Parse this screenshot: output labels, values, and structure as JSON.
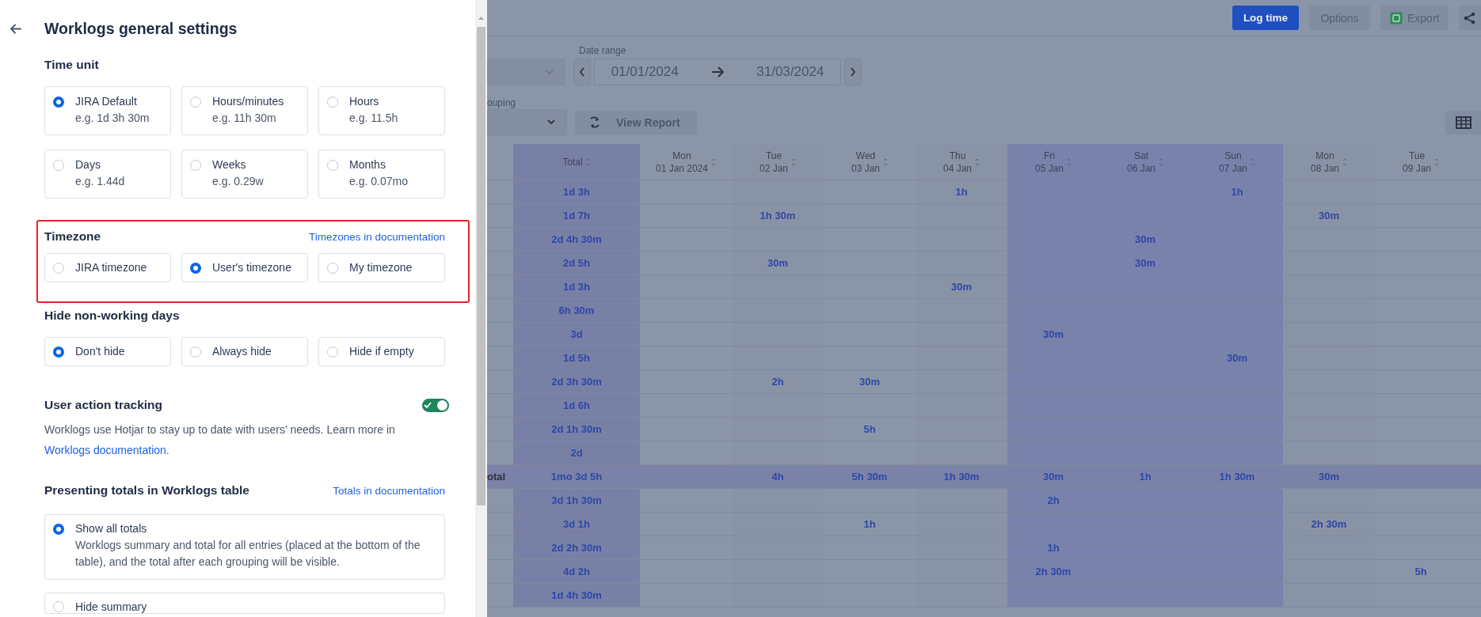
{
  "panel": {
    "title": "Worklogs general settings"
  },
  "time_unit": {
    "title": "Time unit",
    "options": [
      {
        "label": "JIRA Default",
        "example": "e.g. 1d 3h 30m",
        "selected": true
      },
      {
        "label": "Hours/minutes",
        "example": "e.g. 11h 30m",
        "selected": false
      },
      {
        "label": "Hours",
        "example": "e.g. 11.5h",
        "selected": false
      },
      {
        "label": "Days",
        "example": "e.g. 1.44d",
        "selected": false
      },
      {
        "label": "Weeks",
        "example": "e.g. 0.29w",
        "selected": false
      },
      {
        "label": "Months",
        "example": "e.g. 0.07mo",
        "selected": false
      }
    ]
  },
  "timezone": {
    "title": "Timezone",
    "link": "Timezones in documentation",
    "highlighted": true,
    "options": [
      {
        "label": "JIRA timezone",
        "selected": false
      },
      {
        "label": "User's timezone",
        "selected": true
      },
      {
        "label": "My timezone",
        "selected": false
      }
    ]
  },
  "hide_non_working_days": {
    "title": "Hide non-working days",
    "options": [
      {
        "label": "Don't hide",
        "selected": true
      },
      {
        "label": "Always hide",
        "selected": false
      },
      {
        "label": "Hide if empty",
        "selected": false
      }
    ]
  },
  "user_action_tracking": {
    "title": "User action tracking",
    "on": true,
    "description": "Worklogs use Hotjar to stay up to date with users’ needs. Learn more in",
    "link": "Worklogs documentation."
  },
  "presenting_totals": {
    "title": "Presenting totals in Worklogs table",
    "link": "Totals in documentation",
    "options": [
      {
        "label": "Show all totals",
        "description": "Worklogs summary and total for all entries (placed at the bottom of the table), and the total after each grouping will be visible.",
        "selected": true
      },
      {
        "label": "Hide summary",
        "selected": false
      }
    ]
  },
  "backdrop": {
    "toolbar_buttons": [
      {
        "label": "Log time",
        "kind": "primary"
      },
      {
        "label": "Options",
        "kind": "default"
      },
      {
        "label": "Export",
        "kind": "export"
      }
    ],
    "date_range": {
      "label": "Date range",
      "start": "01/01/2024",
      "end": "31/03/2024"
    },
    "grouping_label": "ouping",
    "view_report": "View Report",
    "table": {
      "total_header": "Total",
      "columns": [
        {
          "day": "Mon",
          "date": "01 Jan 2024",
          "highlighted": false
        },
        {
          "day": "Tue",
          "date": "02 Jan",
          "highlighted": false
        },
        {
          "day": "Wed",
          "date": "03 Jan",
          "highlighted": false
        },
        {
          "day": "Thu",
          "date": "04 Jan",
          "highlighted": false
        },
        {
          "day": "Fri",
          "date": "05 Jan",
          "highlighted": true
        },
        {
          "day": "Sat",
          "date": "06 Jan",
          "highlighted": true
        },
        {
          "day": "Sun",
          "date": "07 Jan",
          "highlighted": true
        },
        {
          "day": "Mon",
          "date": "08 Jan",
          "highlighted": false
        },
        {
          "day": "Tue",
          "date": "09 Jan",
          "highlighted": false
        }
      ],
      "rows": [
        {
          "kind": "normal",
          "total": "1d 3h",
          "cells": [
            null,
            null,
            null,
            "1h",
            null,
            null,
            "1h",
            null,
            null
          ]
        },
        {
          "kind": "normal",
          "total": "1d 7h",
          "cells": [
            null,
            "1h 30m",
            null,
            null,
            null,
            null,
            null,
            "30m",
            null
          ]
        },
        {
          "kind": "normal",
          "total": "2d 4h 30m",
          "cells": [
            null,
            null,
            null,
            null,
            null,
            "30m",
            null,
            null,
            null
          ]
        },
        {
          "kind": "normal",
          "total": "2d 5h",
          "cells": [
            null,
            "30m",
            null,
            null,
            null,
            "30m",
            null,
            null,
            null
          ]
        },
        {
          "kind": "normal",
          "total": "1d 3h",
          "cells": [
            null,
            null,
            null,
            "30m",
            null,
            null,
            null,
            null,
            null
          ]
        },
        {
          "kind": "normal",
          "total": "6h 30m",
          "cells": [
            null,
            null,
            null,
            null,
            null,
            null,
            null,
            null,
            null
          ]
        },
        {
          "kind": "normal",
          "total": "3d",
          "cells": [
            null,
            null,
            null,
            null,
            "30m",
            null,
            null,
            null,
            null
          ]
        },
        {
          "kind": "normal",
          "total": "1d 5h",
          "cells": [
            null,
            null,
            null,
            null,
            null,
            null,
            "30m",
            null,
            null
          ]
        },
        {
          "kind": "normal",
          "total": "2d 3h 30m",
          "cells": [
            null,
            "2h",
            "30m",
            null,
            null,
            null,
            null,
            null,
            null
          ]
        },
        {
          "kind": "normal",
          "total": "1d 6h",
          "cells": [
            null,
            null,
            null,
            null,
            null,
            null,
            null,
            null,
            null
          ]
        },
        {
          "kind": "normal",
          "total": "2d 1h 30m",
          "cells": [
            null,
            null,
            "5h",
            null,
            null,
            null,
            null,
            null,
            null
          ]
        },
        {
          "kind": "normal",
          "total": "2d",
          "cells": [
            null,
            null,
            null,
            null,
            null,
            null,
            null,
            null,
            null
          ]
        },
        {
          "kind": "total",
          "label": "otal",
          "total": "1mo 3d 5h",
          "cells": [
            null,
            "4h",
            "5h 30m",
            "1h 30m",
            "30m",
            "1h",
            "1h 30m",
            "30m",
            null
          ]
        },
        {
          "kind": "normal",
          "total": "3d 1h 30m",
          "cells": [
            null,
            null,
            null,
            null,
            "2h",
            null,
            null,
            null,
            null
          ]
        },
        {
          "kind": "normal",
          "total": "3d 1h",
          "cells": [
            null,
            null,
            "1h",
            null,
            null,
            null,
            null,
            "2h 30m",
            null
          ]
        },
        {
          "kind": "normal",
          "total": "2d 2h 30m",
          "cells": [
            null,
            null,
            null,
            null,
            "1h",
            null,
            null,
            null,
            null
          ]
        },
        {
          "kind": "normal",
          "total": "4d 2h",
          "cells": [
            null,
            null,
            null,
            null,
            "2h 30m",
            null,
            null,
            null,
            "5h"
          ]
        },
        {
          "kind": "normal",
          "total": "1d 4h 30m",
          "cells": [
            null,
            null,
            null,
            null,
            null,
            null,
            null,
            null,
            null
          ]
        }
      ]
    }
  }
}
